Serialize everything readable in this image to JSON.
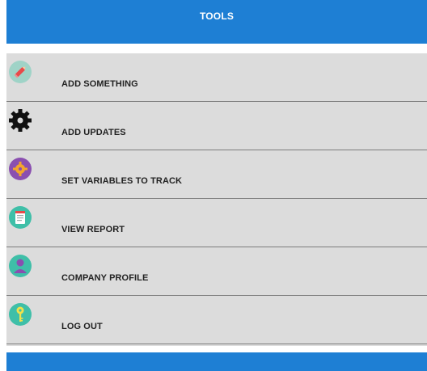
{
  "header": {
    "title": "TOOLS"
  },
  "menu": {
    "items": [
      {
        "label": "ADD SOMETHING",
        "icon": "pencil-icon"
      },
      {
        "label": "ADD UPDATES",
        "icon": "gear-icon"
      },
      {
        "label": "SET VARIABLES TO TRACK",
        "icon": "settings-badge-icon"
      },
      {
        "label": "VIEW REPORT",
        "icon": "report-icon"
      },
      {
        "label": "COMPANY PROFILE",
        "icon": "user-profile-icon"
      },
      {
        "label": "LOG OUT",
        "icon": "key-icon"
      }
    ]
  },
  "colors": {
    "header_bg": "#1e7fd4",
    "menu_bg": "#dcdcdc",
    "divider": "#7d7d7d",
    "icon_teal": "#3fbfa8",
    "icon_purple": "#8a4fb0"
  }
}
